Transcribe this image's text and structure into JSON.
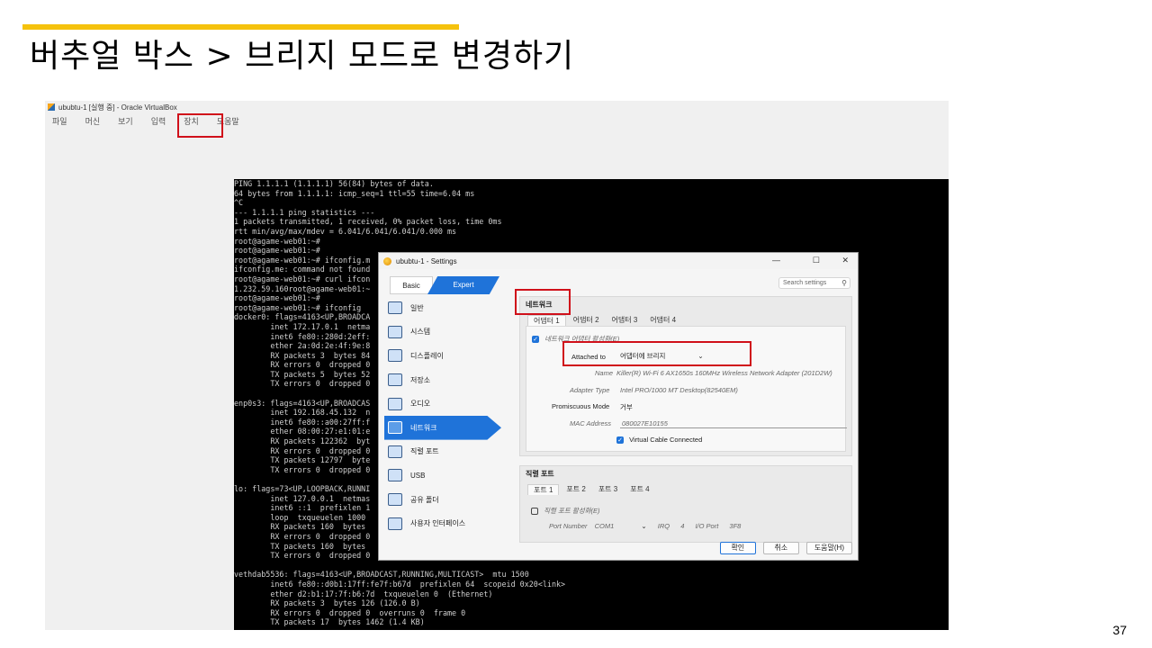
{
  "slide": {
    "title": "버추얼 박스 > 브리지 모드로 변경하기",
    "page_number": "37",
    "accent_color": "#f5c20d"
  },
  "vbox": {
    "window_title": "ububtu-1 [실행 중] - Oracle VirtualBox",
    "menu": [
      "파일",
      "머신",
      "보기",
      "입력",
      "장치",
      "도움말"
    ]
  },
  "terminal": {
    "lines": [
      "PING 1.1.1.1 (1.1.1.1) 56(84) bytes of data.",
      "64 bytes from 1.1.1.1: icmp_seq=1 ttl=55 time=6.04 ms",
      "^C",
      "--- 1.1.1.1 ping statistics ---",
      "1 packets transmitted, 1 received, 0% packet loss, time 0ms",
      "rtt min/avg/max/mdev = 6.041/6.041/6.041/0.000 ms",
      "root@agame-web01:~#",
      "root@agame-web01:~#",
      "root@agame-web01:~# ifconfig.m",
      "ifconfig.me: command not found",
      "root@agame-web01:~# curl ifcon",
      "1.232.59.160root@agame-web01:~",
      "root@agame-web01:~#",
      "root@agame-web01:~# ifconfig",
      "docker0: flags=4163<UP,BROADCA",
      "        inet 172.17.0.1  netma",
      "        inet6 fe80::280d:2eff:",
      "        ether 2a:0d:2e:4f:9e:8",
      "        RX packets 3  bytes 84",
      "        RX errors 0  dropped 0",
      "        TX packets 5  bytes 52",
      "        TX errors 0  dropped 0",
      "",
      "enp0s3: flags=4163<UP,BROADCAS",
      "        inet 192.168.45.132  n",
      "        inet6 fe80::a00:27ff:f",
      "        ether 08:00:27:e1:01:e",
      "        RX packets 122362  byt",
      "        RX errors 0  dropped 0",
      "        TX packets 12797  byte",
      "        TX errors 0  dropped 0",
      "",
      "lo: flags=73<UP,LOOPBACK,RUNNI",
      "        inet 127.0.0.1  netmas",
      "        inet6 ::1  prefixlen 1",
      "        loop  txqueuelen 1000",
      "        RX packets 160  bytes",
      "        RX errors 0  dropped 0",
      "        TX packets 160  bytes",
      "        TX errors 0  dropped 0  overruns 0  carrier 0  collisions 0",
      "",
      "vethdab5536: flags=4163<UP,BROADCAST,RUNNING,MULTICAST>  mtu 1500",
      "        inet6 fe80::d0b1:17ff:fe7f:b67d  prefixlen 64  scopeid 0x20<link>",
      "        ether d2:b1:17:7f:b6:7d  txqueuelen 0  (Ethernet)",
      "        RX packets 3  bytes 126 (126.0 B)",
      "        RX errors 0  dropped 0  overruns 0  frame 0",
      "        TX packets 17  bytes 1462 (1.4 KB)"
    ]
  },
  "settings": {
    "title": "ububtu-1 - Settings",
    "win_controls": [
      "—",
      "☐",
      "✕"
    ],
    "tab_basic": "Basic",
    "tab_expert": "Expert",
    "search_placeholder": "Search settings",
    "nav": [
      {
        "label": "일반",
        "icon": "general-icon"
      },
      {
        "label": "시스템",
        "icon": "system-icon"
      },
      {
        "label": "디스플레이",
        "icon": "display-icon"
      },
      {
        "label": "저장소",
        "icon": "storage-icon"
      },
      {
        "label": "오디오",
        "icon": "audio-icon"
      },
      {
        "label": "네트워크",
        "icon": "network-icon"
      },
      {
        "label": "직렬 포트",
        "icon": "serial-port-icon"
      },
      {
        "label": "USB",
        "icon": "usb-icon"
      },
      {
        "label": "공유 폴더",
        "icon": "shared-folder-icon"
      },
      {
        "label": "사용자 인터페이스",
        "icon": "user-interface-icon"
      }
    ],
    "active_nav": "네트워크",
    "network": {
      "section_title": "네트워크",
      "adapters": [
        "어댑터 1",
        "어댑터 2",
        "어댑터 3",
        "어댑터 4"
      ],
      "enable_label": "네트워크 어댑터 활성화(E)",
      "attached_label": "Attached to",
      "attached_value": "어댑터에 브리지",
      "name_label": "Name",
      "name_value": "Killer(R) Wi-Fi 6 AX1650s 160MHz Wireless Network Adapter (201D2W)",
      "adapter_type_label": "Adapter Type",
      "adapter_type_value": "Intel PRO/1000 MT Desktop(82540EM)",
      "promiscuous_label": "Promiscuous Mode",
      "promiscuous_value": "거부",
      "mac_label": "MAC Address",
      "mac_value": "080027E10155",
      "cable_label": "Virtual Cable Connected"
    },
    "serial": {
      "section_title": "직렬 포트",
      "ports": [
        "포트 1",
        "포트 2",
        "포트 3",
        "포트 4"
      ],
      "enable_label": "직렬 포트 활성화(E)",
      "port_number_label": "Port Number",
      "port_number_value": "COM1",
      "irq_label": "IRQ",
      "irq_value": "4",
      "io_label": "I/O Port",
      "io_value": "3F8"
    },
    "buttons": {
      "ok": "확인",
      "cancel": "취소",
      "help": "도움말(H)"
    }
  }
}
